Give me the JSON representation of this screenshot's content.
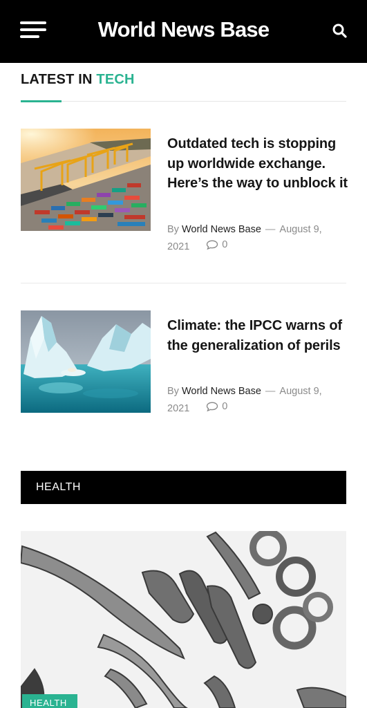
{
  "header": {
    "site_title": "World News Base",
    "menu_icon": "hamburger-menu-icon",
    "search_icon": "search-icon"
  },
  "section": {
    "prefix": "LATEST IN ",
    "accent": "TECH",
    "accent_color": "#2ab391"
  },
  "articles": [
    {
      "title": "Outdated tech is stopping up worldwide exchange. Here’s the way to unblock it",
      "by": "By",
      "author": "World News Base",
      "date_line1": "August 9,",
      "date_line2": "2021",
      "comments": "0",
      "image": "container-port-photo"
    },
    {
      "title": "Climate: the IPCC warns of the generalization of perils",
      "by": "By",
      "author": "World News Base",
      "date_line1": "August 9,",
      "date_line2": "2021",
      "comments": "0",
      "image": "iceberg-photo"
    }
  ],
  "health": {
    "heading": "HEALTH",
    "badge": "HEALTH",
    "image": "virus-micrograph-photo"
  },
  "colors": {
    "header_bg": "#000000",
    "accent": "#2ab391",
    "text": "#161616",
    "meta": "#8a8a8a"
  }
}
